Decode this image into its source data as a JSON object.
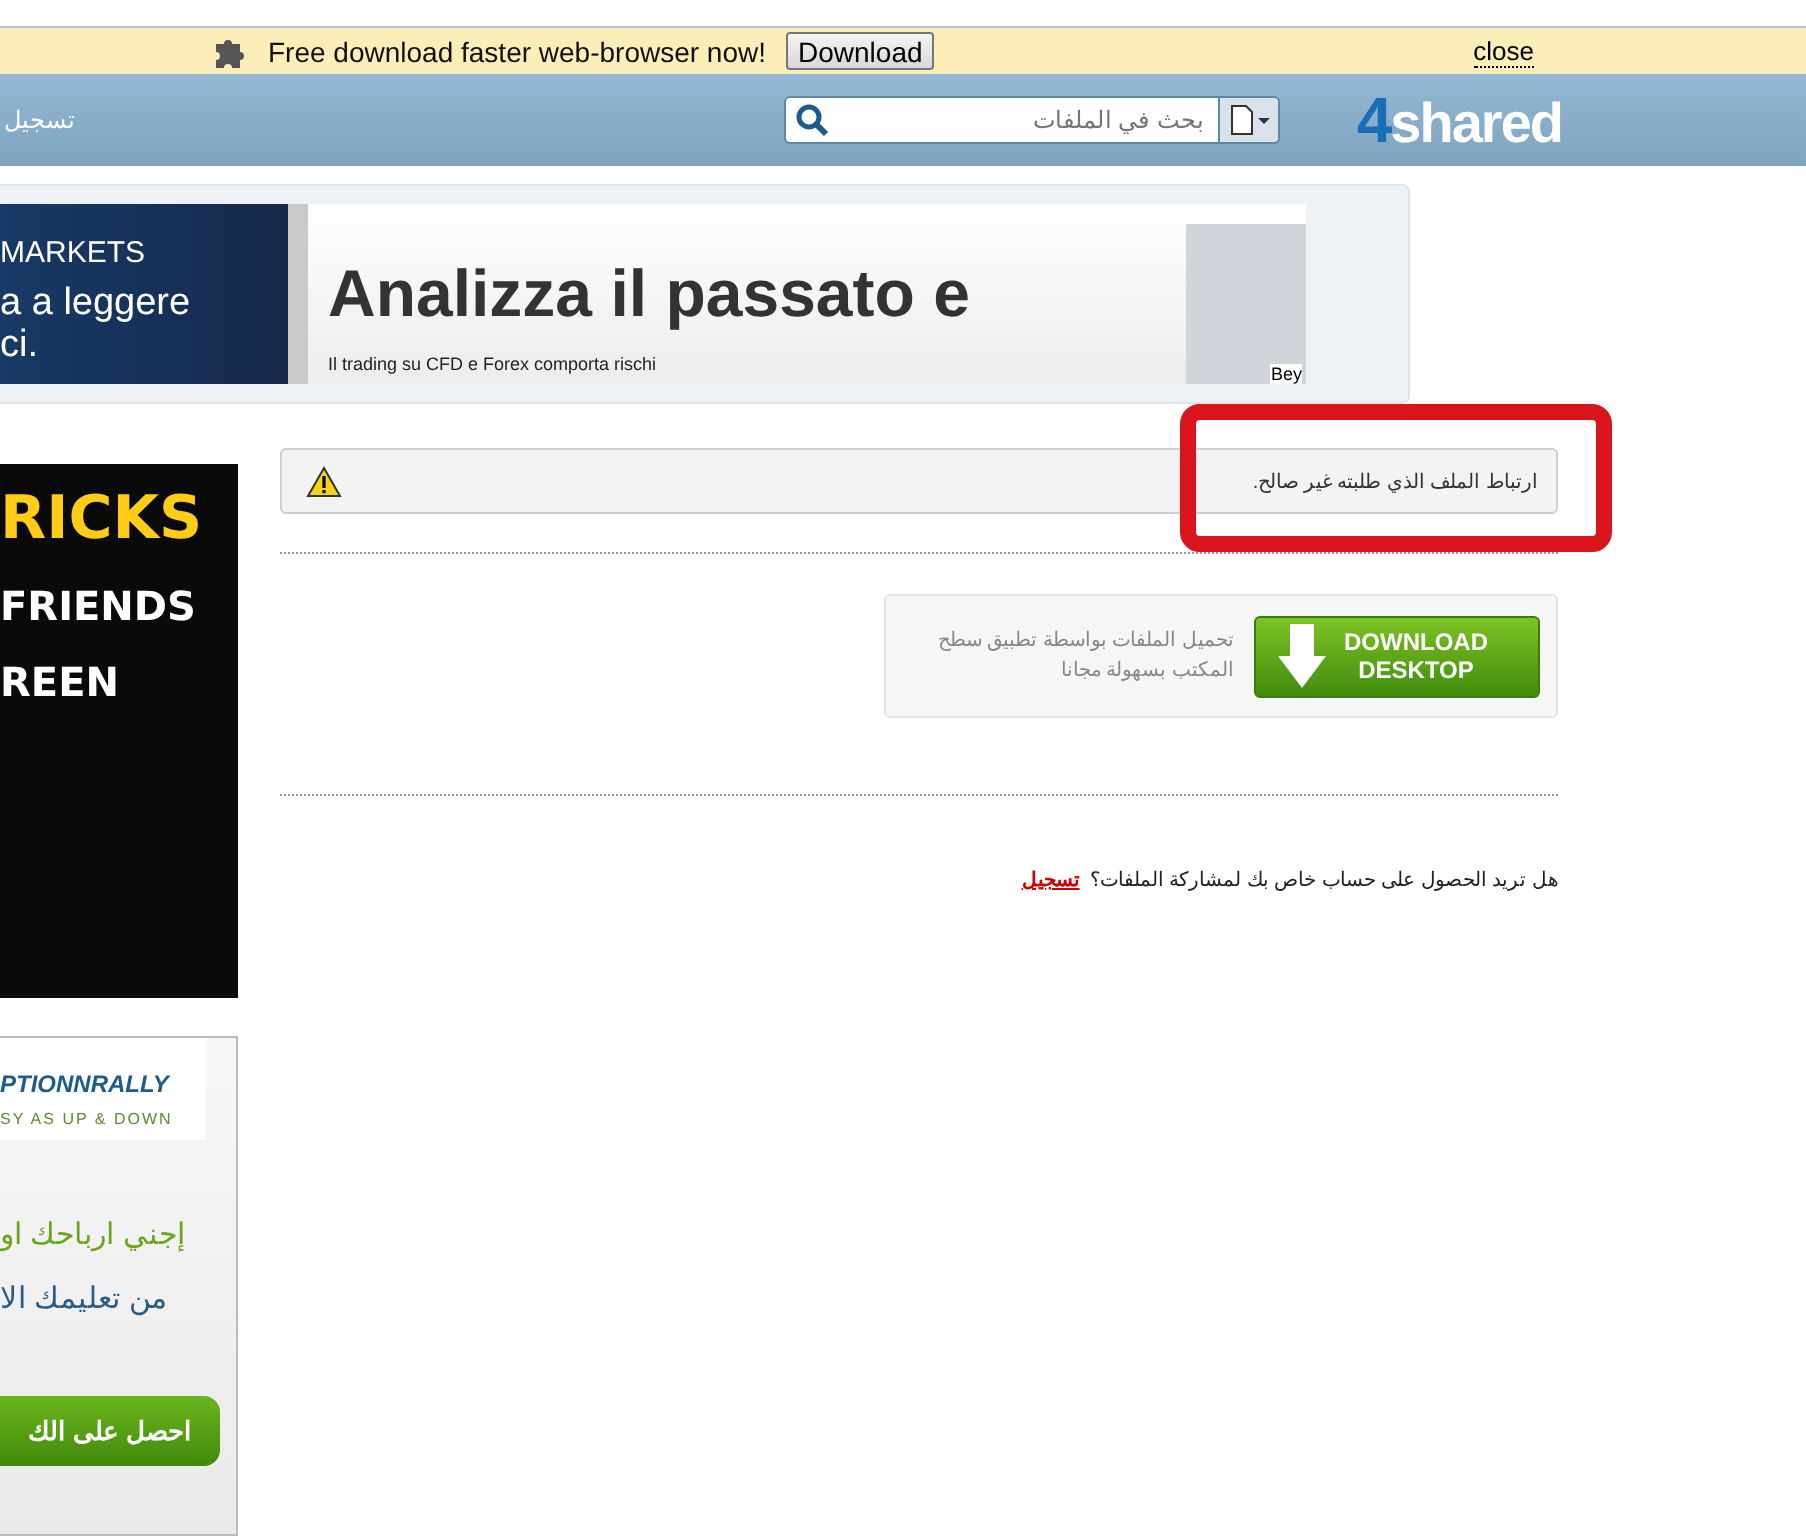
{
  "promo_bar": {
    "message": "Free download faster web-browser now!",
    "button": "Download",
    "close": "close"
  },
  "header": {
    "signup_link": "تسجيل",
    "search": {
      "placeholder": "بحث في الملفات"
    },
    "logo_digit": "4",
    "logo_word": "shared"
  },
  "top_banner": {
    "left_lines": [
      "MARKETS",
      "a a leggere",
      "ci."
    ],
    "headline": "Analizza il passato e",
    "disclaimer": "Il trading su CFD e Forex comporta rischi",
    "corner_tag": "Bey"
  },
  "side_ads": [
    {
      "kind": "dark",
      "lines": [
        "RICKS",
        "FRIENDS",
        "REEN"
      ]
    },
    {
      "kind": "light",
      "brand": "PTIONNRALLY",
      "tagline": "SY AS UP & DOWN",
      "lines": [
        "إجني ارباحك او",
        "من تعليمك الا"
      ],
      "button": "احصل على الك"
    }
  ],
  "alert": {
    "message": "ارتباط الملف الذي طلبته غير صالح.",
    "highlighted": true
  },
  "desktop_promo": {
    "description": "تحميل الملفات بواسطة تطبيق سطح المكتب بسهولة مجانا",
    "button_line1": "DOWNLOAD",
    "button_line2": "DESKTOP"
  },
  "signup_prompt": {
    "question": "هل تريد الحصول على حساب خاص بك لمشاركة الملفات؟",
    "link": "تسجيل"
  }
}
